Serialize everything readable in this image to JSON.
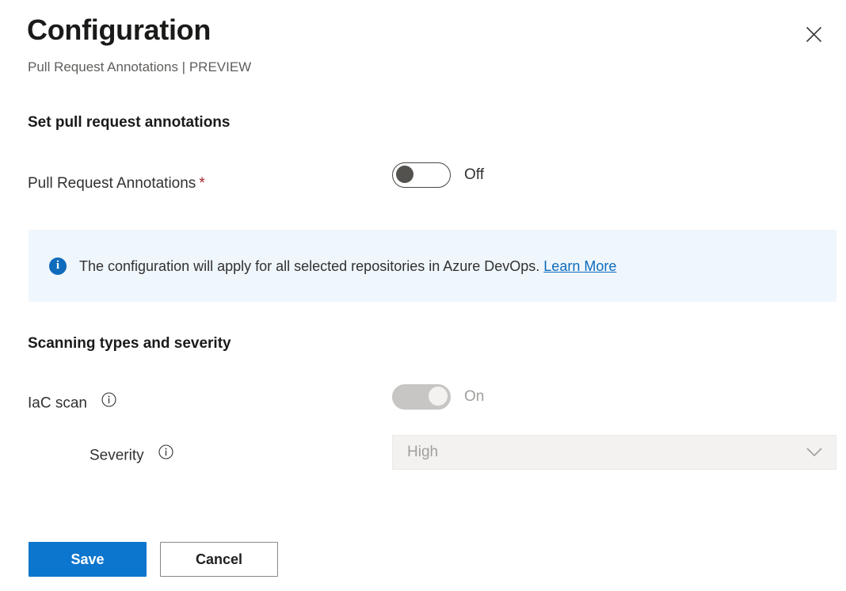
{
  "header": {
    "title": "Configuration",
    "subtitle": "Pull Request Annotations | PREVIEW",
    "close_icon": "close-icon"
  },
  "sections": {
    "annotations": {
      "heading": "Set pull request annotations",
      "field": {
        "label": "Pull Request Annotations",
        "required_marker": "*",
        "toggle_state_label": "Off",
        "toggle_value": "off"
      }
    },
    "scanning": {
      "heading": "Scanning types and severity",
      "iac_scan": {
        "label": "IaC scan",
        "info_icon": "info-circle-icon",
        "toggle_state_label": "On",
        "toggle_value": "on",
        "disabled": true
      },
      "severity": {
        "label": "Severity",
        "info_icon": "info-circle-icon",
        "selected_value": "High",
        "chevron_icon": "chevron-down-icon",
        "disabled": true
      }
    }
  },
  "info_banner": {
    "icon": "info-filled-icon",
    "text": "The configuration will apply for all selected repositories in Azure DevOps.",
    "link_label": "Learn More",
    "background_color": "#eff6fc",
    "icon_color": "#0f6cbd"
  },
  "footer": {
    "save_label": "Save",
    "cancel_label": "Cancel",
    "primary_color": "#0c76ce"
  }
}
